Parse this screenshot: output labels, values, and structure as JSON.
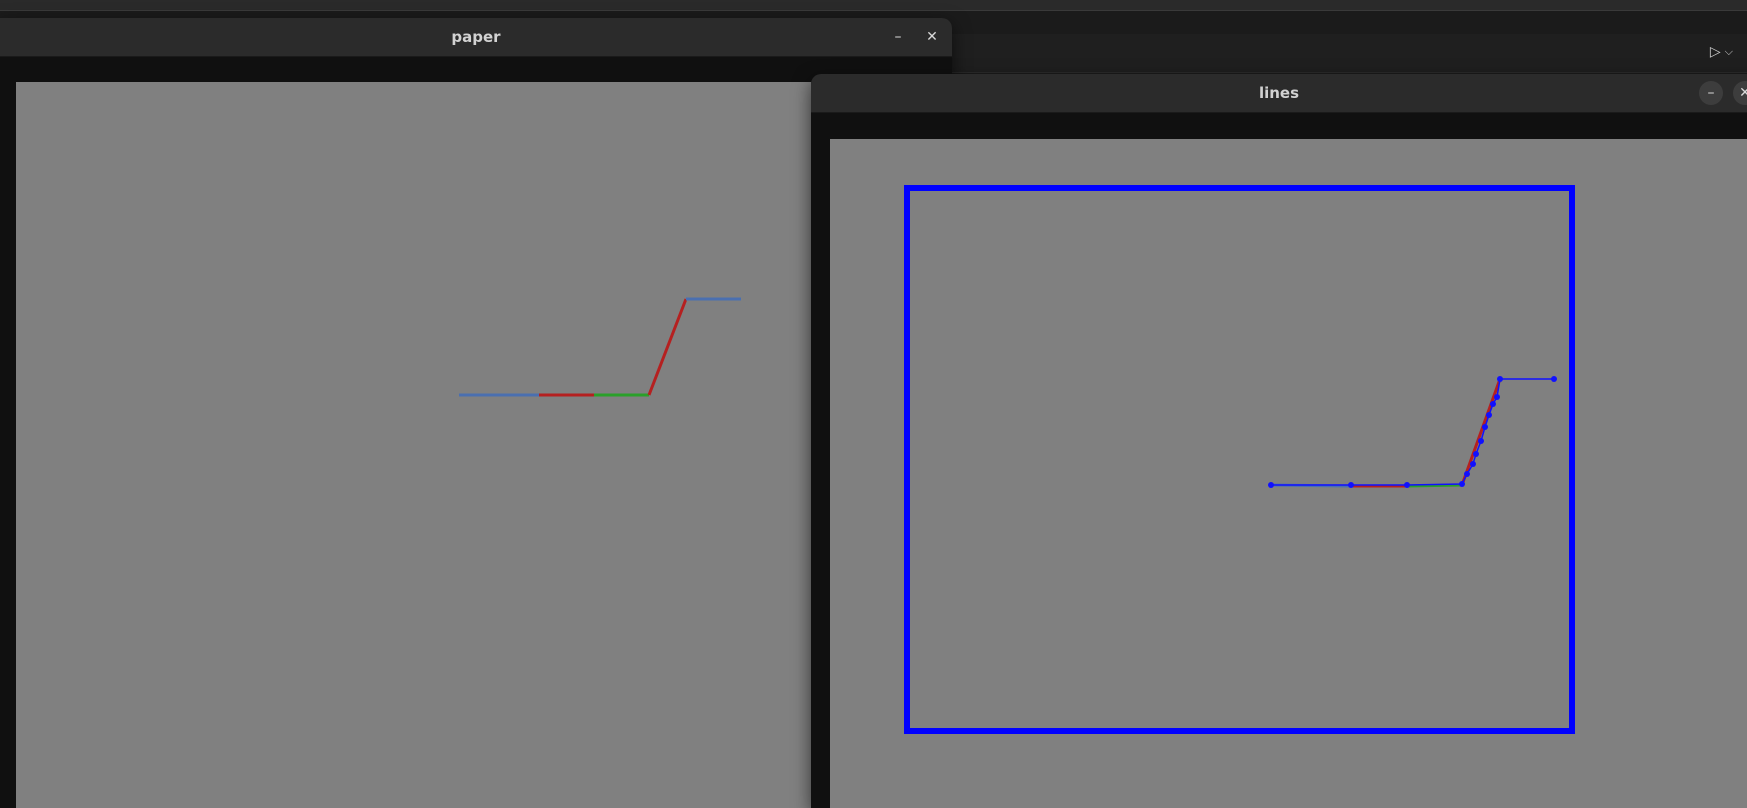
{
  "windows": {
    "paper": {
      "title": "paper",
      "minimize_icon": "minimize-icon",
      "close_icon": "close-icon"
    },
    "lines": {
      "title": "lines",
      "minimize_icon": "minimize-icon",
      "close_icon": "close-icon"
    }
  },
  "background_app": {
    "run_icon": "play-icon",
    "dropdown_icon": "chevron-down-icon"
  },
  "colors": {
    "canvas_gray": "#808080",
    "line_blue": "#4a6fb0",
    "line_red": "#b52020",
    "line_green": "#2aa02a",
    "bbox_blue": "#0000ff",
    "point_blue": "#1010ff"
  },
  "glyphs": {
    "minimize": "–",
    "close": "✕",
    "play": "▷",
    "chevron": "⌵"
  }
}
